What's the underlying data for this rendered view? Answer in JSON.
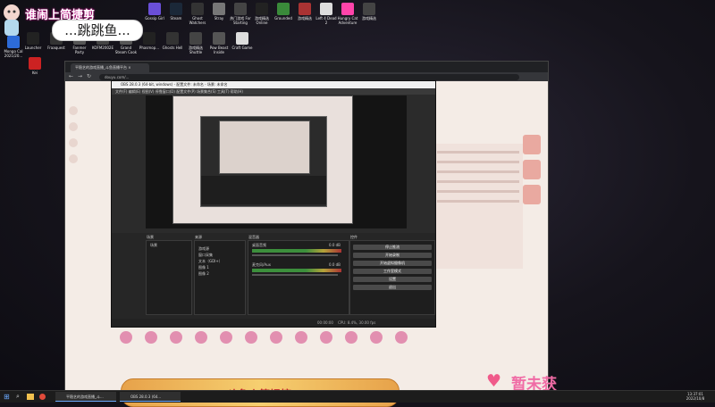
{
  "overlay": {
    "title": "谁闹上简捷剪",
    "bubble": "...跳跳鱼...",
    "stream_text": "暂未获",
    "heart_color": "#f05a8a"
  },
  "desktop_icons": [
    {
      "label": "Gossip Girl",
      "color": "#6a4fd8"
    },
    {
      "label": "Steam",
      "color": "#1b2838"
    },
    {
      "label": "Ghost Watchers",
      "color": "#333"
    },
    {
      "label": "Stray",
      "color": "#777"
    },
    {
      "label": "热门游戏 For Starting",
      "color": "#444"
    },
    {
      "label": "游戏精选 Online",
      "color": "#222"
    },
    {
      "label": "Grounded",
      "color": "#3a8a3a"
    },
    {
      "label": "游戏精选",
      "color": "#a33"
    },
    {
      "label": "Left 4 Dead 2",
      "color": "#ddd"
    },
    {
      "label": "Hungry Cat Adventure",
      "color": "#f4a"
    },
    {
      "label": "游戏精选",
      "color": "#444"
    },
    {
      "label": "Launcher",
      "color": "#222"
    },
    {
      "label": "Fraaquest",
      "color": "#333"
    },
    {
      "label": "Fanmer Party",
      "color": "#555"
    },
    {
      "label": "KOFM2002E",
      "color": "#444"
    },
    {
      "label": "Grand Steam Cook",
      "color": "#555"
    },
    {
      "label": "Phasmop...",
      "color": "#222"
    },
    {
      "label": "Ghosts Hell",
      "color": "#333"
    },
    {
      "label": "游戏精选 Shuttle",
      "color": "#444"
    },
    {
      "label": "Pow Beast Inside",
      "color": "#555"
    },
    {
      "label": "Craft Game",
      "color": "#ddd"
    },
    {
      "label": "Mongo Cal 2021/20...",
      "color": "#2d6bd8"
    },
    {
      "label": "Kei",
      "color": "#c22"
    }
  ],
  "browser": {
    "tab_title": "平稳艺的游戏直播_斗鱼直播平台 ×",
    "url": "douyu.com/..."
  },
  "obs": {
    "title": "OBS 28.0.3 (64-bit, windows) - 配置文件: 未命名 - 场景: 未命名",
    "menu": "文件(F)  编辑(E)  视图(V)  停靠窗口(D)  配置文件(P)  场景集合(S)  工具(T)  帮助(H)",
    "panels": {
      "scenes": "场景",
      "sources": "来源",
      "mixer": "混音器",
      "controls": "控件"
    },
    "scene_items": [
      "场景"
    ],
    "source_items": [
      "游戏源",
      "窗口采集",
      "文本（GDI+）",
      "图像 1",
      "图像 2"
    ],
    "mixer_channels": [
      {
        "name": "桌面音频",
        "db": "0.0 dB"
      },
      {
        "name": "麦克风/Aux",
        "db": "0.0 dB"
      }
    ],
    "control_buttons": [
      "停止推流",
      "开始录制",
      "开始虚拟摄像机",
      "工作室模式",
      "设置",
      "退出"
    ],
    "status": "CPU: 8.4%, 30.00 fps",
    "timer": "00:00:00"
  },
  "gold_banner": {
    "text": "斗鱼火箭提搞"
  },
  "taskbar": {
    "apps": [
      {
        "label": "平稳艺的游戏直播_斗..."
      },
      {
        "label": "OBS 28.0.3 (64..."
      }
    ],
    "clock_time": "13:37:01",
    "clock_date": "2022/10/8"
  }
}
